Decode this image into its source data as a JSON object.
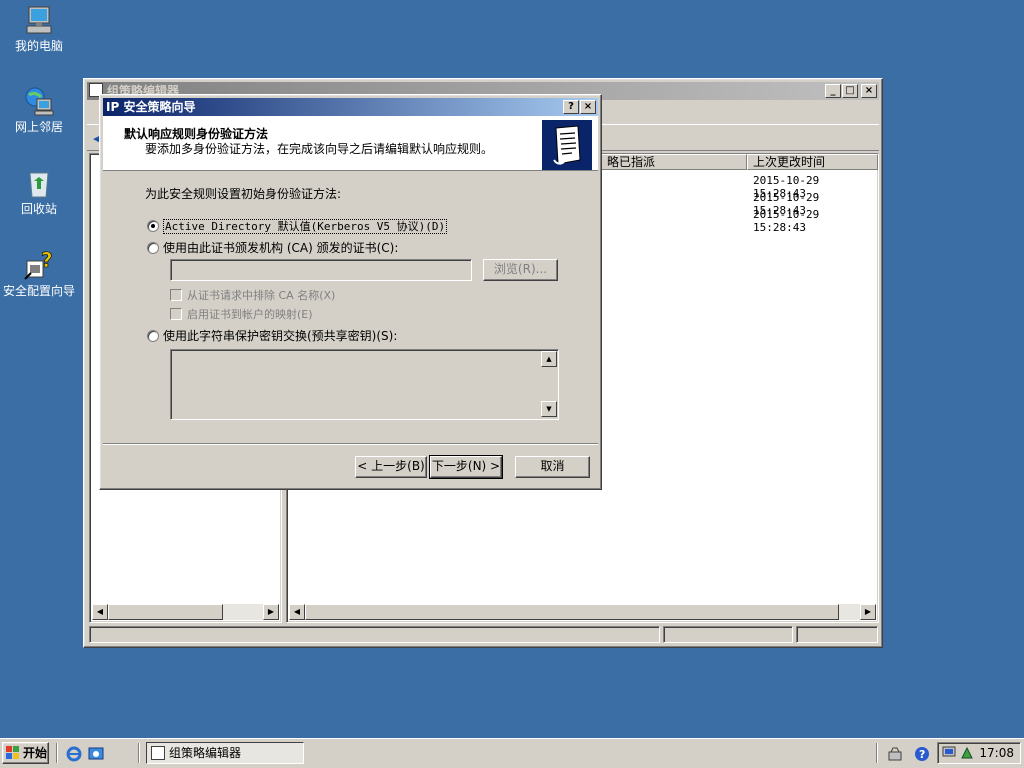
{
  "desktop": {
    "icons": [
      {
        "label": "我的电脑",
        "icon": "computer-icon"
      },
      {
        "label": "网上邻居",
        "icon": "network-icon"
      },
      {
        "label": "回收站",
        "icon": "recycle-bin-icon"
      },
      {
        "label": "安全配置向导",
        "icon": "security-wizard-icon"
      }
    ]
  },
  "gpe": {
    "title": "组策略编辑器",
    "columns": {
      "policy_assigned": "略已指派",
      "last_modified": "上次更改时间"
    },
    "rows": [
      {
        "last_modified": "2015-10-29 15:28:43"
      },
      {
        "last_modified": "2015-10-29 15:28:43"
      },
      {
        "last_modified": "2015-10-29 15:28:43"
      }
    ]
  },
  "wizard": {
    "title": "IP 安全策略向导",
    "header_title": "默认响应规则身份验证方法",
    "header_subtitle": "要添加多身份验证方法，在完成该向导之后请编辑默认响应规则。",
    "prompt": "为此安全规则设置初始身份验证方法:",
    "option_ad": "Active Directory 默认值(Kerberos V5 协议)(D)",
    "option_cert": "使用由此证书颁发机构 (CA) 颁发的证书(C):",
    "browse_label": "浏览(R)...",
    "chk_exclude_ca": "从证书请求中排除 CA 名称(X)",
    "chk_mapping": "启用证书到帐户的映射(E)",
    "option_psk": "使用此字符串保护密钥交换(预共享密钥)(S):",
    "back_label": "< 上一步(B)",
    "next_label": "下一步(N) >",
    "cancel_label": "取消",
    "selected_option": "active-directory"
  },
  "taskbar": {
    "start_label": "开始",
    "task_label": "组策略编辑器",
    "clock": "17:08"
  },
  "colors": {
    "desktop": "#3a6ea5",
    "title_active": "#0a246a",
    "title_inactive": "#808080",
    "face": "#d4d0c8"
  }
}
